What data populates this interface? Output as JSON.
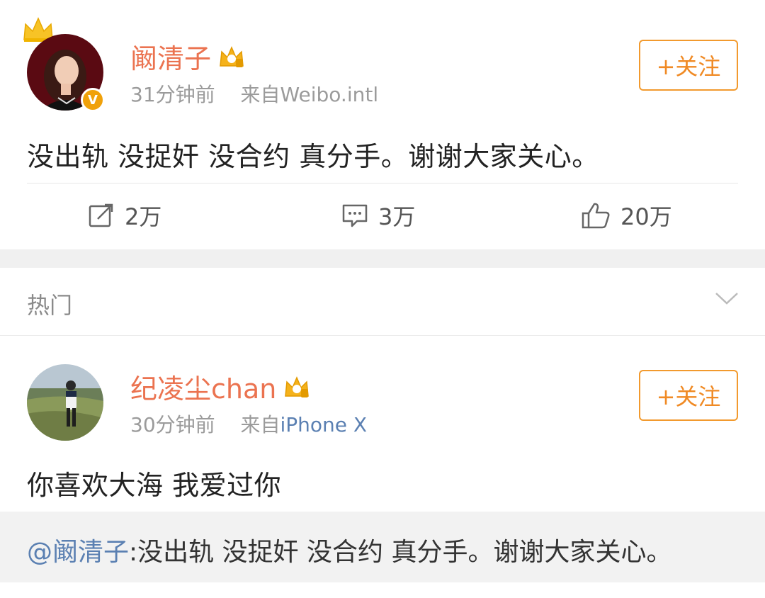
{
  "post": {
    "author": "阚清子",
    "time": "31分钟前",
    "source_prefix": "来自",
    "source": "Weibo.intl",
    "verified_badge": "V",
    "follow_label": "+关注",
    "text": "没出轨 没捉奸 没合约 真分手。谢谢大家关心。",
    "actions": {
      "repost_count": "2万",
      "comment_count": "3万",
      "like_count": "20万"
    }
  },
  "hot_section": {
    "label": "热门"
  },
  "comment": {
    "author": "纪凌尘chan",
    "time": "30分钟前",
    "source_prefix": "来自",
    "source": "iPhone X",
    "follow_label": "+关注",
    "text": "你喜欢大海 我爱过你",
    "quote_mention": "@阚清子",
    "quote_text": ":没出轨 没捉奸 没合约 真分手。谢谢大家关心。"
  },
  "colors": {
    "name_orange": "#eb7350",
    "follow_orange": "#f29a2e",
    "link_blue": "#5b80b2",
    "separator_gray": "#f0f0f0"
  }
}
